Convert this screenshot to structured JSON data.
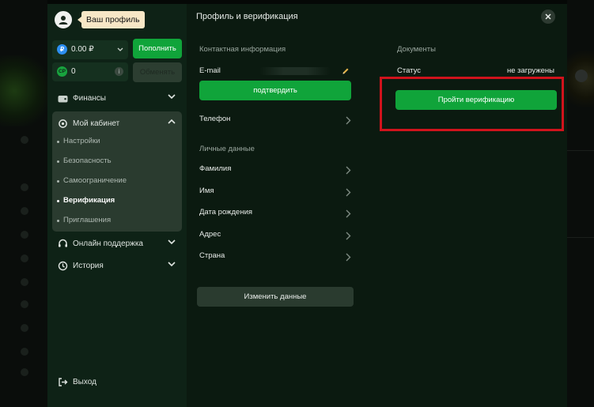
{
  "sidebar": {
    "profile_tooltip": "Ваш профиль",
    "balance": {
      "value": "0.00 ₽",
      "coin_glyph": "₽"
    },
    "bonus": {
      "value": "0",
      "coin_glyph": "CP"
    },
    "deposit_label": "Пополнить",
    "exchange_label": "Обменять",
    "finance_label": "Финансы",
    "cabinet_label": "Мой кабинет",
    "cabinet_items": [
      {
        "label": "Настройки",
        "active": false
      },
      {
        "label": "Безопасность",
        "active": false
      },
      {
        "label": "Самоограничение",
        "active": false
      },
      {
        "label": "Верификация",
        "active": true
      },
      {
        "label": "Приглашения",
        "active": false
      }
    ],
    "support_label": "Онлайн поддержка",
    "history_label": "История",
    "logout_label": "Выход"
  },
  "main": {
    "title": "Профиль и верификация",
    "contact_section": "Контактная информация",
    "email_label": "E-mail",
    "confirm_label": "подтвердить",
    "phone_label": "Телефон",
    "personal_section": "Личные данные",
    "personal_fields": [
      "Фамилия",
      "Имя",
      "Дата рождения",
      "Адрес",
      "Страна"
    ],
    "change_label": "Изменить данные",
    "documents_section": "Документы",
    "status_label": "Статус",
    "status_value": "не загружены",
    "verify_label": "Пройти верификацию"
  },
  "colors": {
    "accent_green": "#10a43a",
    "highlight_red": "#d0131c",
    "tooltip_bg": "#f7e7c6"
  }
}
